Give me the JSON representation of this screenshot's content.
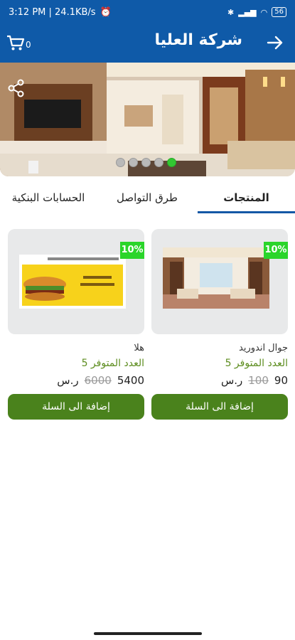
{
  "status_bar": {
    "time": "3:12 PM | 24.1KB/s",
    "battery": "56"
  },
  "header": {
    "title": "شركة العليا",
    "cart_count": "0"
  },
  "banner": {
    "slides": 5,
    "active_slide_index": 4,
    "share_icon": "share-icon"
  },
  "tabs": [
    {
      "label": "المنتجات",
      "active": true
    },
    {
      "label": "طرق التواصل",
      "active": false
    },
    {
      "label": "الحسابات البنكية",
      "active": false
    }
  ],
  "products": [
    {
      "discount": "10%",
      "name": "جوال اندوريد",
      "stock": "العدد المتوفر 5",
      "price": "90",
      "old_price": "100",
      "currency": "ر.س",
      "add_label": "إضافة الى السلة"
    },
    {
      "discount": "10%",
      "name": "هلا",
      "stock": "العدد المتوفر 5",
      "price": "5400",
      "old_price": "6000",
      "currency": "ر.س",
      "add_label": "إضافة الى السلة"
    }
  ],
  "colors": {
    "primary": "#0f5aa8",
    "button_green": "#4a821c",
    "stock_green": "#5d8d1f",
    "discount_green": "#2ad52a"
  }
}
